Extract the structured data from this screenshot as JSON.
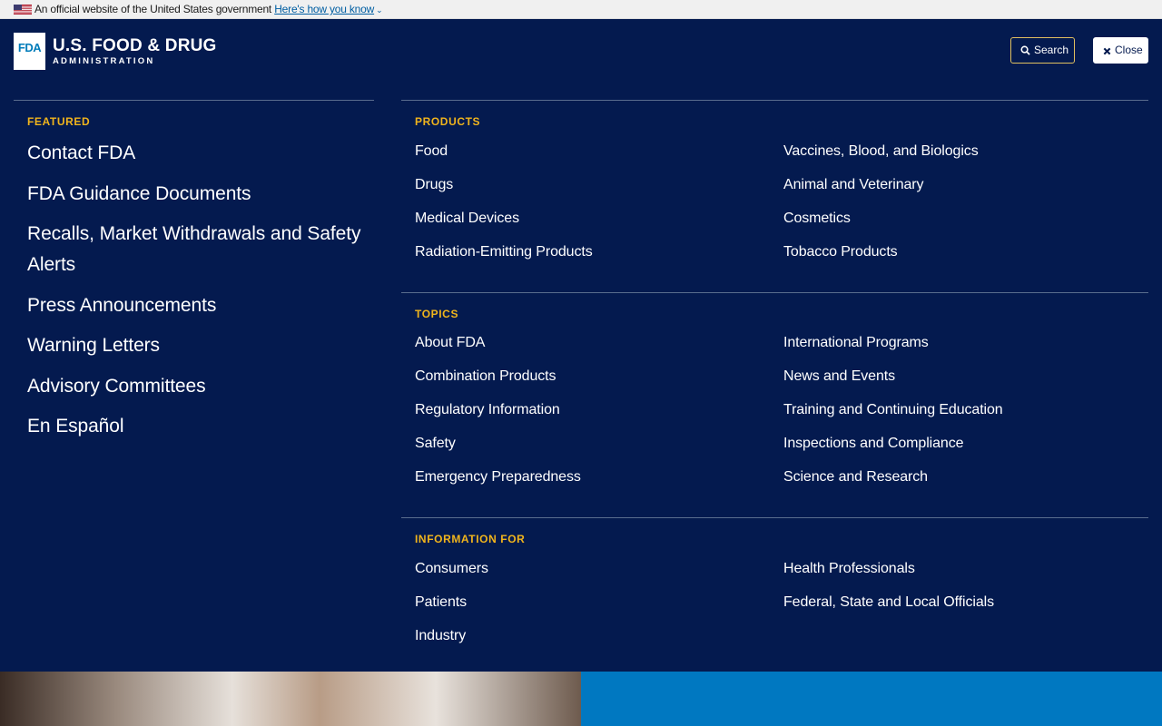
{
  "gov_banner": {
    "text": "An official website of the United States government",
    "link": "Here's how you know"
  },
  "logo": {
    "box": "FDA",
    "main": "U.S. FOOD & DRUG",
    "sub": "ADMINISTRATION"
  },
  "header": {
    "search_label": "Search",
    "close_label": "Close"
  },
  "featured": {
    "heading": "FEATURED",
    "items": [
      "Contact FDA",
      "FDA Guidance Documents",
      "Recalls, Market Withdrawals and Safety Alerts",
      "Press Announcements",
      "Warning Letters",
      "Advisory Committees",
      "En Español"
    ]
  },
  "products": {
    "heading": "PRODUCTS",
    "col1": [
      "Food",
      "Drugs",
      "Medical Devices",
      "Radiation-Emitting Products"
    ],
    "col2": [
      "Vaccines, Blood, and Biologics",
      "Animal and Veterinary",
      "Cosmetics",
      "Tobacco Products"
    ]
  },
  "topics": {
    "heading": "TOPICS",
    "col1": [
      "About FDA",
      "Combination Products",
      "Regulatory Information",
      "Safety",
      "Emergency Preparedness"
    ],
    "col2": [
      "International Programs",
      "News and Events",
      "Training and Continuing Education",
      "Inspections and Compliance",
      "Science and Research"
    ]
  },
  "info_for": {
    "heading": "INFORMATION FOR",
    "col1": [
      "Consumers",
      "Patients",
      "Industry"
    ],
    "col2": [
      "Health Professionals",
      "Federal, State and Local Officials"
    ]
  },
  "colors": {
    "background": "#041a4f",
    "heading": "#f1b51c",
    "hero_blue": "#0078c1"
  }
}
